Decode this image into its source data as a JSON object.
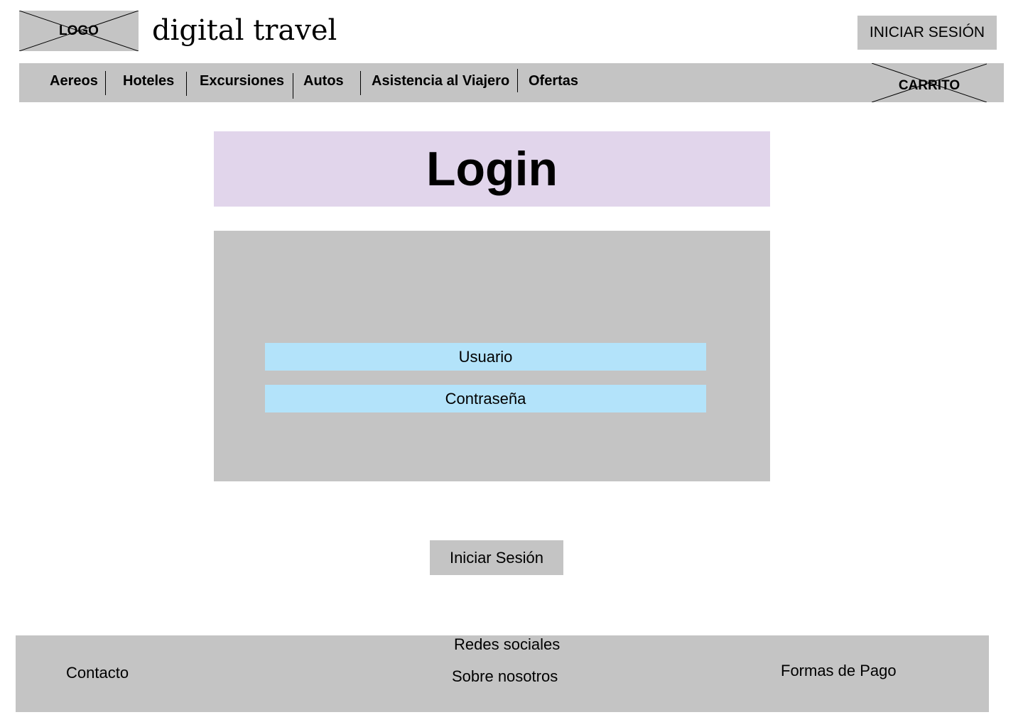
{
  "header": {
    "logo_label": "LOGO",
    "site_title": "digital travel",
    "login_button": "INICIAR SESIÓN"
  },
  "nav": {
    "items": [
      {
        "label": "Aereos"
      },
      {
        "label": "Hoteles"
      },
      {
        "label": "Excursiones"
      },
      {
        "label": "Autos"
      },
      {
        "label": "Asistencia al Viajero"
      },
      {
        "label": "Ofertas"
      }
    ],
    "cart_label": "CARRITO"
  },
  "main": {
    "title": "Login",
    "username_placeholder": "Usuario",
    "password_placeholder": "Contraseña",
    "submit_label": "Iniciar Sesión"
  },
  "footer": {
    "contact": "Contacto",
    "social": "Redes sociales",
    "about": "Sobre nosotros",
    "payment": "Formas de Pago"
  },
  "colors": {
    "placeholder_gray": "#c4c4c4",
    "login_header_bg": "#e1d5eb",
    "input_bg": "#b3e3fa"
  },
  "icons": {
    "logo": "image-placeholder-icon",
    "cart": "image-placeholder-icon"
  }
}
